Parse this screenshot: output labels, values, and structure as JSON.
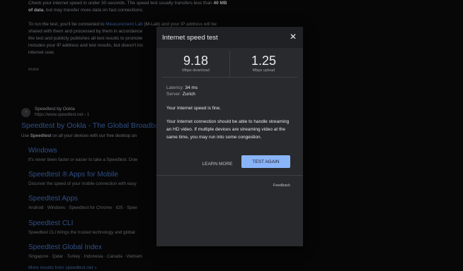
{
  "background": {
    "intro_line1": "Check your internet speed in under 30 seconds. The speed test usually transfers less than",
    "intro_bold1": "40 MB",
    "intro_line2_bold": "of data",
    "intro_line2": ", but may transfer more data on fast connections.",
    "para_lines": [
      "To run the test, you'll be connected to",
      "shared with them and processed by them in accordance",
      "the test and publicly publishes all test results to promote",
      "includes your IP address and test results, but doesn't inc",
      "internet user."
    ],
    "mlab_link": "Measurement Lab",
    "mlab_suffix": "(M-Lab) and your IP address will be",
    "expand_text": "more",
    "site_name": "Speedtest by Ookla",
    "site_url": "https://www.speedtest.net",
    "site_url_suffix": "› 1",
    "result_title": "Speedtest by Ookla - The Global Broadba",
    "result_desc_prefix": "Use",
    "result_desc_bold": "Speedtest",
    "result_desc": "on all your devices with our free desktop an",
    "sitelinks": [
      {
        "title": "Windows",
        "desc": "It's never been faster or easier to take a Speedtest. Dow"
      },
      {
        "title": "Speedtest ® Apps for Mobile",
        "desc": "Discover the speed of your mobile connection with easy"
      },
      {
        "title": "Speedtest Apps",
        "desc": "Android · Windows · Speedtest for Chrome · iOS · Spee"
      },
      {
        "title": "Speedtest CLI",
        "desc": "Speedtest CLI brings the trusted technology and global"
      },
      {
        "title": "Speedtest Global Index",
        "desc": "Singapore · Qatar · Turkey · Indonesia · Canada · Vietnam"
      }
    ],
    "more_results": "More results from speedtest.net »"
  },
  "dialog": {
    "title": "Internet speed test",
    "close_icon": "close-icon",
    "download_value": "9.18",
    "download_unit": "Mbps download",
    "upload_value": "1.25",
    "upload_unit": "Mbps upload",
    "latency_label": "Latency:",
    "latency_value": "34 ms",
    "server_label": "Server:",
    "server_value": "Zurich",
    "status": "Your Internet speed is fine.",
    "description": "Your Internet connection should be able to handle streaming an HD video. If multiple devices are streaming video at the same time, you may run into some congestion.",
    "learn_more": "LEARN MORE",
    "test_again": "TEST AGAIN",
    "feedback": "Feedback"
  },
  "colors": {
    "accent": "#8ab4f8",
    "link": "#4a79c9",
    "dialog_bg": "#292a2d"
  }
}
